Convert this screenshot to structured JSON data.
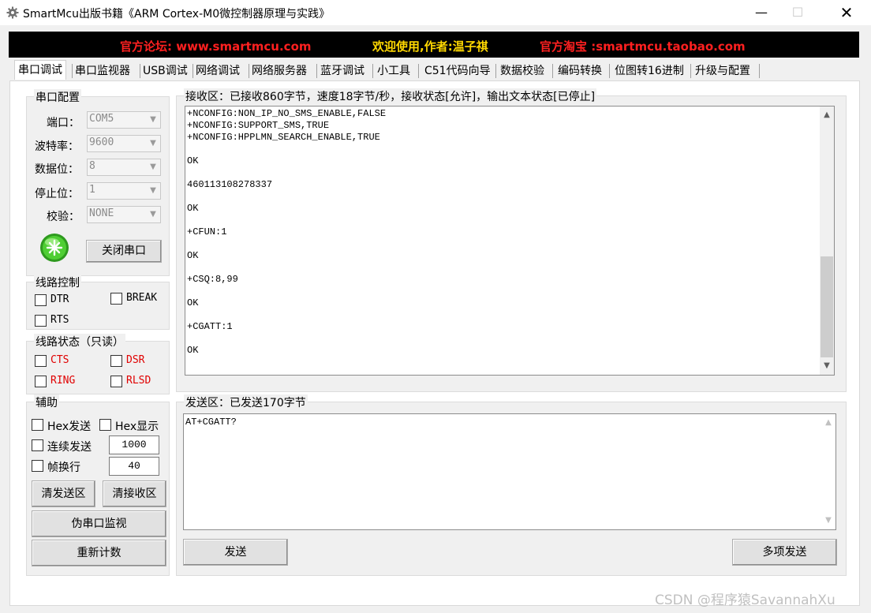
{
  "window": {
    "title": "SmartMcu出版书籍《ARM Cortex-M0微控制器原理与实践》",
    "min_icon": "—",
    "max_icon": "☐",
    "close_icon": "✕"
  },
  "banner": {
    "forum": "官方论坛: www.smartmcu.com",
    "welcome": "欢迎使用,作者:温子祺",
    "taobao": "官方淘宝 :smartmcu.taobao.com"
  },
  "tabs": [
    "串口调试",
    "串口监视器",
    "USB调试",
    "网络调试",
    "网络服务器",
    "蓝牙调试",
    "小工具",
    "C51代码向导",
    "数据校验",
    "编码转换",
    "位图转16进制",
    "升级与配置"
  ],
  "serial_config": {
    "title": "串口配置",
    "port_label": "端口：",
    "port_value": "COM5",
    "baud_label": "波特率：",
    "baud_value": "9600",
    "data_label": "数据位：",
    "data_value": "8",
    "stop_label": "停止位：",
    "stop_value": "1",
    "parity_label": "校验：",
    "parity_value": "NONE",
    "close_button": "关闭串口"
  },
  "line_control": {
    "title": "线路控制",
    "dtr": "DTR",
    "break": "BREAK",
    "rts": "RTS"
  },
  "line_status": {
    "title": "线路状态（只读）",
    "cts": "CTS",
    "dsr": "DSR",
    "ring": "RING",
    "rlsd": "RLSD"
  },
  "aux": {
    "title": "辅助",
    "hex_send": "Hex发送",
    "hex_show": "Hex显示",
    "continuous": "连续发送",
    "continuous_value": "1000",
    "frame": "帧换行",
    "frame_value": "40",
    "clear_send": "清发送区",
    "clear_recv": "清接收区",
    "fake_monitor": "伪串口监视",
    "recount": "重新计数"
  },
  "receive": {
    "title": "接收区：已接收860字节，速度18字节/秒，接收状态[允许]，输出文本状态[已停止]",
    "text": "+NCONFIG:NON_IP_NO_SMS_ENABLE,FALSE\n+NCONFIG:SUPPORT_SMS,TRUE\n+NCONFIG:HPPLMN_SEARCH_ENABLE,TRUE\n\nOK\n\n460113108278337\n\nOK\n\n+CFUN:1\n\nOK\n\n+CSQ:8,99\n\nOK\n\n+CGATT:1\n\nOK"
  },
  "send": {
    "title": "发送区：已发送170字节",
    "text": "AT+CGATT?",
    "send_button": "发送",
    "multi_button": "多项发送"
  },
  "watermark": "CSDN @程序猿SavannahXu",
  "colors": {
    "banner_bg": "#000000",
    "banner_red": "#ff2020",
    "banner_yellow": "#ffd800",
    "status_red": "#e00000",
    "led_green": "#3fbf2a"
  }
}
